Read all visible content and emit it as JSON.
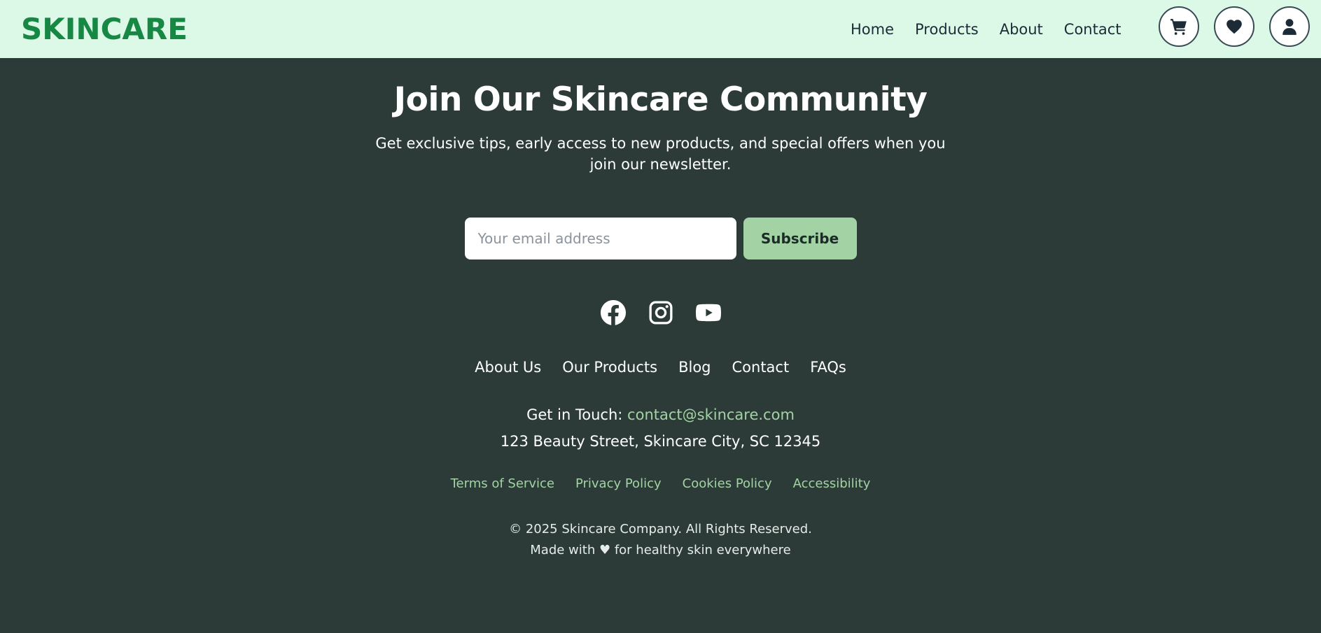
{
  "header": {
    "logo": "SKINCARE",
    "nav": [
      "Home",
      "Products",
      "About",
      "Contact"
    ],
    "icons": [
      "cart-icon",
      "heart-icon",
      "user-icon"
    ]
  },
  "newsletter": {
    "title": "Join Our Skincare Community",
    "subtitle": "Get exclusive tips, early access to new products, and special offers when you join our newsletter.",
    "email_placeholder": "Your email address",
    "subscribe_label": "Subscribe"
  },
  "social": [
    "facebook-icon",
    "instagram-icon",
    "youtube-icon"
  ],
  "footer_nav": [
    "About Us",
    "Our Products",
    "Blog",
    "Contact",
    "FAQs"
  ],
  "contact": {
    "label": "Get in Touch:",
    "email": "contact@skincare.com",
    "address": "123 Beauty Street, Skincare City, SC 12345"
  },
  "legal": [
    "Terms of Service",
    "Privacy Policy",
    "Cookies Policy",
    "Accessibility"
  ],
  "copyright": {
    "line1": "© 2025 Skincare Company. All Rights Reserved.",
    "line2": "Made with ♥ for healthy skin everywhere"
  },
  "colors": {
    "header_bg": "#dcf9e8",
    "logo": "#178844",
    "page_bg": "#2c3b38",
    "accent": "#a3d3a4"
  }
}
